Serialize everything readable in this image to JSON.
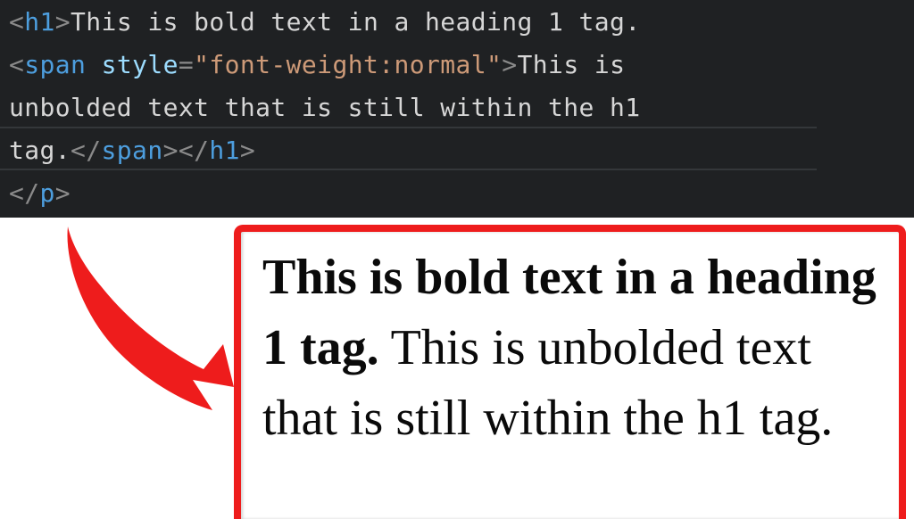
{
  "code_editor": {
    "background_color": "#1f2123",
    "syntax_colors": {
      "punctuation": "#8a8a8a",
      "tag": "#4d9ede",
      "attribute": "#9cdcfe",
      "string": "#cd9a78",
      "text": "#d6d6d6"
    },
    "lines": [
      {
        "id": "line-1",
        "tokens": [
          {
            "type": "punct",
            "text": "<"
          },
          {
            "type": "tag",
            "text": "h1"
          },
          {
            "type": "punct",
            "text": ">"
          },
          {
            "type": "text",
            "text": "This is bold text in a heading 1 tag."
          }
        ]
      },
      {
        "id": "line-2",
        "tokens": [
          {
            "type": "punct",
            "text": "<"
          },
          {
            "type": "tag",
            "text": "span"
          },
          {
            "type": "text",
            "text": " "
          },
          {
            "type": "attr",
            "text": "style"
          },
          {
            "type": "punct",
            "text": "="
          },
          {
            "type": "string",
            "text": "\"font-weight:normal\""
          },
          {
            "type": "punct",
            "text": ">"
          },
          {
            "type": "text",
            "text": "This is"
          }
        ]
      },
      {
        "id": "line-3",
        "tokens": [
          {
            "type": "text",
            "text": "unbolded text that is still within the h1"
          }
        ]
      },
      {
        "id": "line-4",
        "tokens": [
          {
            "type": "text",
            "text": "tag."
          },
          {
            "type": "punct",
            "text": "</"
          },
          {
            "type": "tag",
            "text": "span"
          },
          {
            "type": "punct",
            "text": ">"
          },
          {
            "type": "punct",
            "text": "</"
          },
          {
            "type": "tag",
            "text": "h1"
          },
          {
            "type": "punct",
            "text": ">"
          }
        ]
      },
      {
        "id": "line-5",
        "tokens": [
          {
            "type": "punct",
            "text": "</"
          },
          {
            "type": "tag",
            "text": "p"
          },
          {
            "type": "punct",
            "text": ">"
          }
        ]
      }
    ]
  },
  "annotation": {
    "arrow_color": "#ee1c1c",
    "arrow_name": "curved-down-right-arrow"
  },
  "render_box": {
    "border_color": "#ee1c1c",
    "background_color": "#ffffff",
    "bold_text": "This is bold text in a heading 1 tag.",
    "normal_text": " This is unbolded text that is still within the h1 tag."
  }
}
